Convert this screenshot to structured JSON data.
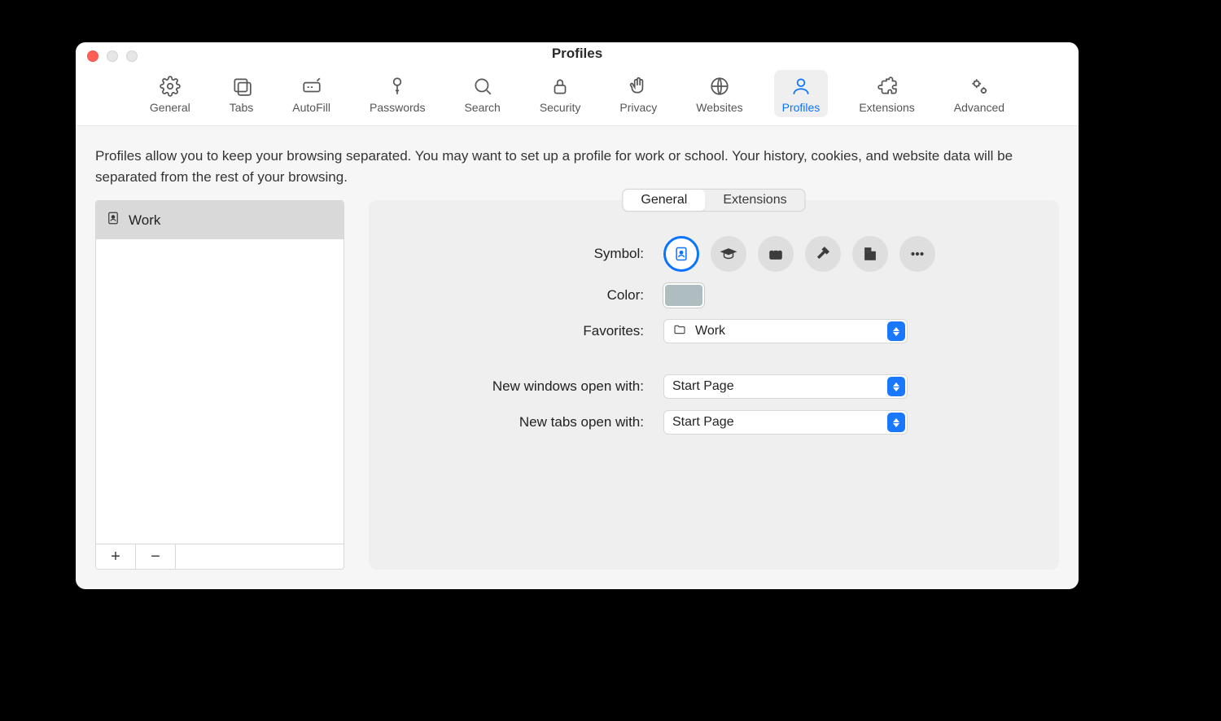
{
  "window": {
    "title": "Profiles"
  },
  "toolbar": {
    "items": [
      {
        "label": "General",
        "id": "general"
      },
      {
        "label": "Tabs",
        "id": "tabs"
      },
      {
        "label": "AutoFill",
        "id": "autofill"
      },
      {
        "label": "Passwords",
        "id": "passwords"
      },
      {
        "label": "Search",
        "id": "search"
      },
      {
        "label": "Security",
        "id": "security"
      },
      {
        "label": "Privacy",
        "id": "privacy"
      },
      {
        "label": "Websites",
        "id": "websites"
      },
      {
        "label": "Profiles",
        "id": "profiles",
        "active": true
      },
      {
        "label": "Extensions",
        "id": "extensions"
      },
      {
        "label": "Advanced",
        "id": "advanced"
      }
    ]
  },
  "description": "Profiles allow you to keep your browsing separated. You may want to set up a profile for work or school. Your history, cookies, and website data will be separated from the rest of your browsing.",
  "profiles": {
    "items": [
      {
        "name": "Work"
      }
    ]
  },
  "segmented": {
    "general": "General",
    "extensions": "Extensions"
  },
  "form": {
    "symbol_label": "Symbol:",
    "color_label": "Color:",
    "favorites_label": "Favorites:",
    "favorites_value": "Work",
    "new_windows_label": "New windows open with:",
    "new_windows_value": "Start Page",
    "new_tabs_label": "New tabs open with:",
    "new_tabs_value": "Start Page",
    "color_value": "#aebdc0"
  },
  "symbols": [
    "badge",
    "graduation",
    "briefcase",
    "hammer",
    "building",
    "more"
  ],
  "footer_buttons": {
    "add": "+",
    "remove": "−"
  }
}
